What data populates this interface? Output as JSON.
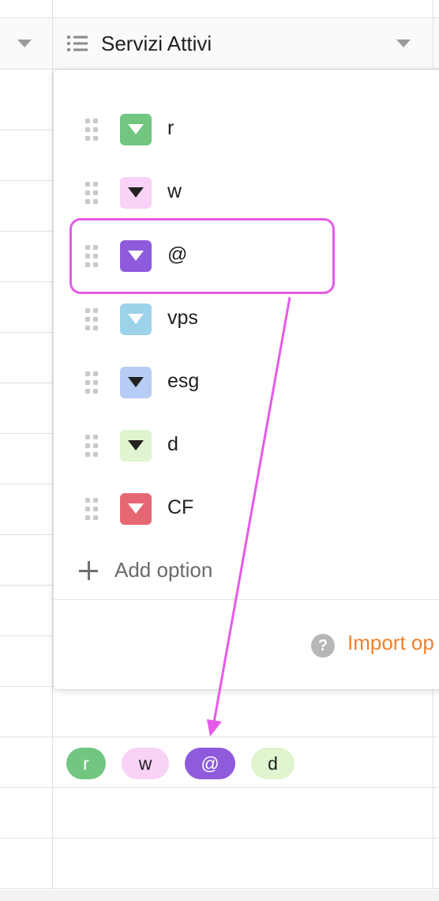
{
  "header": {
    "field_title": "Servizi Attivi",
    "field_type_icon": "list-icon",
    "dropdown_icon": "chevron-down-icon"
  },
  "options": [
    {
      "label": "r",
      "color": "#72c680",
      "icon_color": "#ffffff"
    },
    {
      "label": "w",
      "color": "#f8d2f7",
      "icon_color": "#222222"
    },
    {
      "label": "@",
      "color": "#8e5bdc",
      "icon_color": "#ffffff"
    },
    {
      "label": "vps",
      "color": "#9cd2ea",
      "icon_color": "#ffffff"
    },
    {
      "label": "esg",
      "color": "#b8cdf5",
      "icon_color": "#222222"
    },
    {
      "label": "d",
      "color": "#dff4cf",
      "icon_color": "#222222"
    },
    {
      "label": "CF",
      "color": "#e56773",
      "icon_color": "#ffffff"
    }
  ],
  "add_option_label": "Add option",
  "import_label": "Import op",
  "help_icon": "question-icon",
  "help_symbol": "?",
  "highlighted_option": "@",
  "annotation": {
    "color": "#e65ae8"
  },
  "cell_tags": [
    {
      "label": "r",
      "color": "#72c680",
      "text_color": "#ffffff"
    },
    {
      "label": "w",
      "color": "#f8d2f7",
      "text_color": "#1f1f1f"
    },
    {
      "label": "@",
      "color": "#8e5bdc",
      "text_color": "#ffffff"
    },
    {
      "label": "d",
      "color": "#dff4cf",
      "text_color": "#1f1f1f"
    }
  ]
}
